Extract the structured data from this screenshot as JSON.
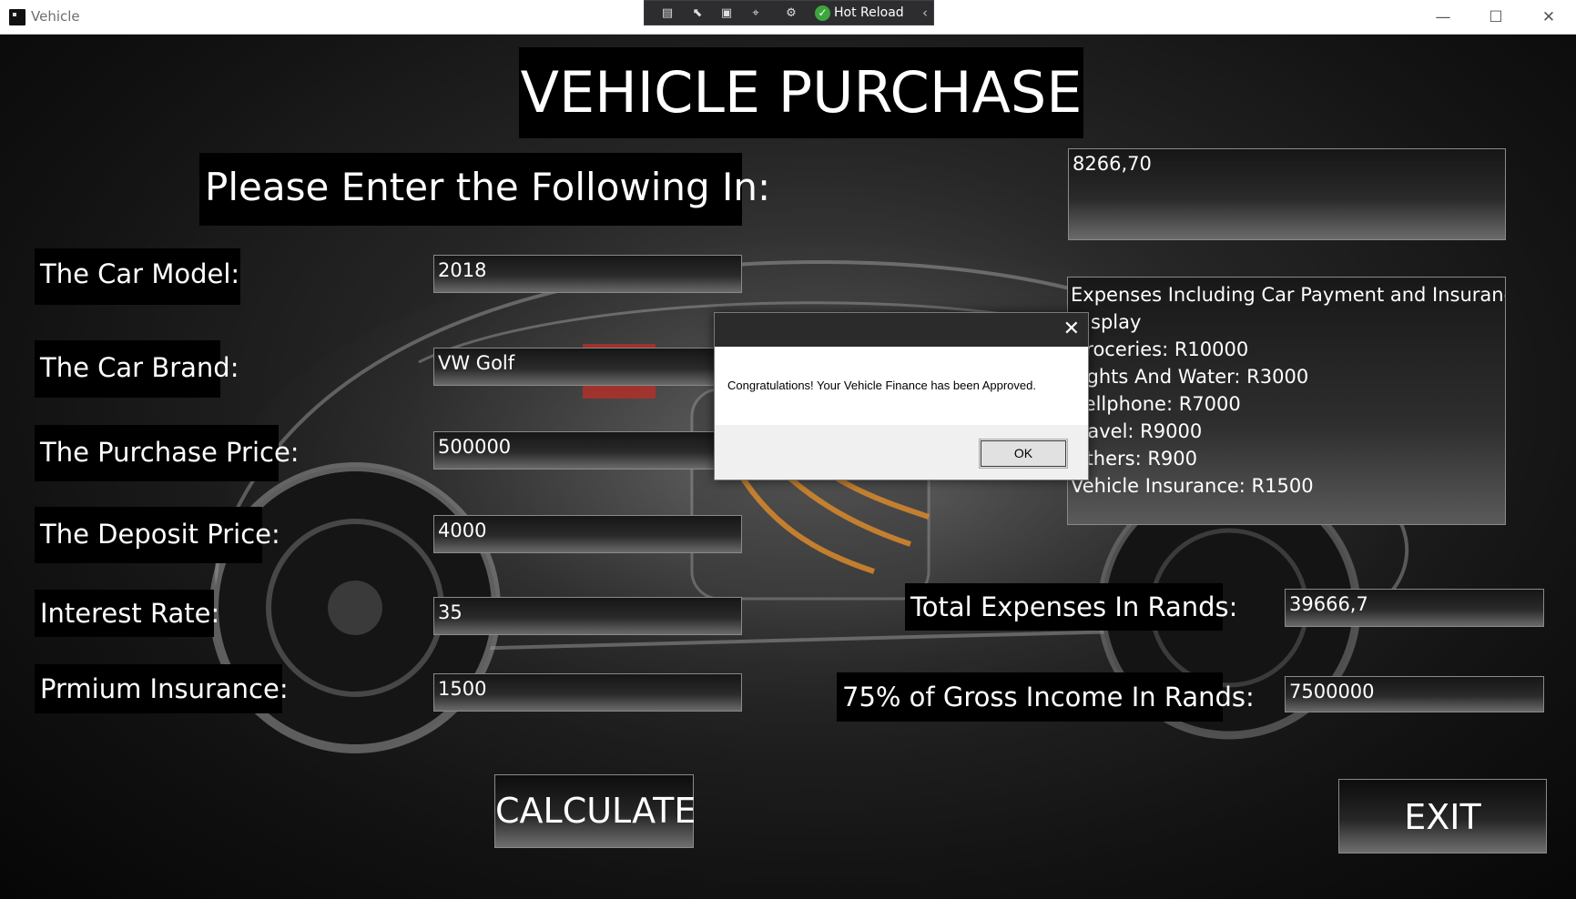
{
  "window": {
    "title": "Vehicle",
    "minimize_glyph": "—",
    "maximize_glyph": "☐",
    "close_glyph": "✕"
  },
  "debug_toolbar": {
    "hot_reload_label": "Hot Reload",
    "hot_reload_icon": "✓",
    "collapse_glyph": "‹"
  },
  "form": {
    "heading": "VEHICLE PURCHASE",
    "subheading": "Please Enter the Following In:",
    "fields": {
      "car_model": {
        "label": "The Car Model:",
        "value": "2018"
      },
      "car_brand": {
        "label": "The Car Brand:",
        "value": "VW Golf"
      },
      "purchase_price": {
        "label": "The Purchase Price:",
        "value": "500000"
      },
      "deposit_price": {
        "label": "The Deposit Price:",
        "value": "4000"
      },
      "interest_rate": {
        "label": "Interest Rate:",
        "value": "35"
      },
      "premium_insurance": {
        "label": "Prmium Insurance:",
        "value": "1500"
      }
    }
  },
  "results": {
    "monthly_payment": "8266,70",
    "expenses_list": [
      "Expenses Including Car Payment and Insurance",
      "Display",
      "Groceries: R10000",
      "Lights And Water: R3000",
      "Cellphone: R7000",
      "Travel: R9000",
      "Others: R900",
      "Vehicle Insurance: R1500"
    ],
    "total_expenses_label": "Total Expenses In Rands:",
    "total_expenses_value": "39666,7",
    "gross_income_label": "75% of Gross Income In Rands:",
    "gross_income_value": "7500000"
  },
  "buttons": {
    "calculate": "CALCULATE",
    "exit": "EXIT"
  },
  "dialog": {
    "message": "Congratulations! Your Vehicle Finance has been Approved.",
    "ok": "OK",
    "close_glyph": "✕"
  }
}
